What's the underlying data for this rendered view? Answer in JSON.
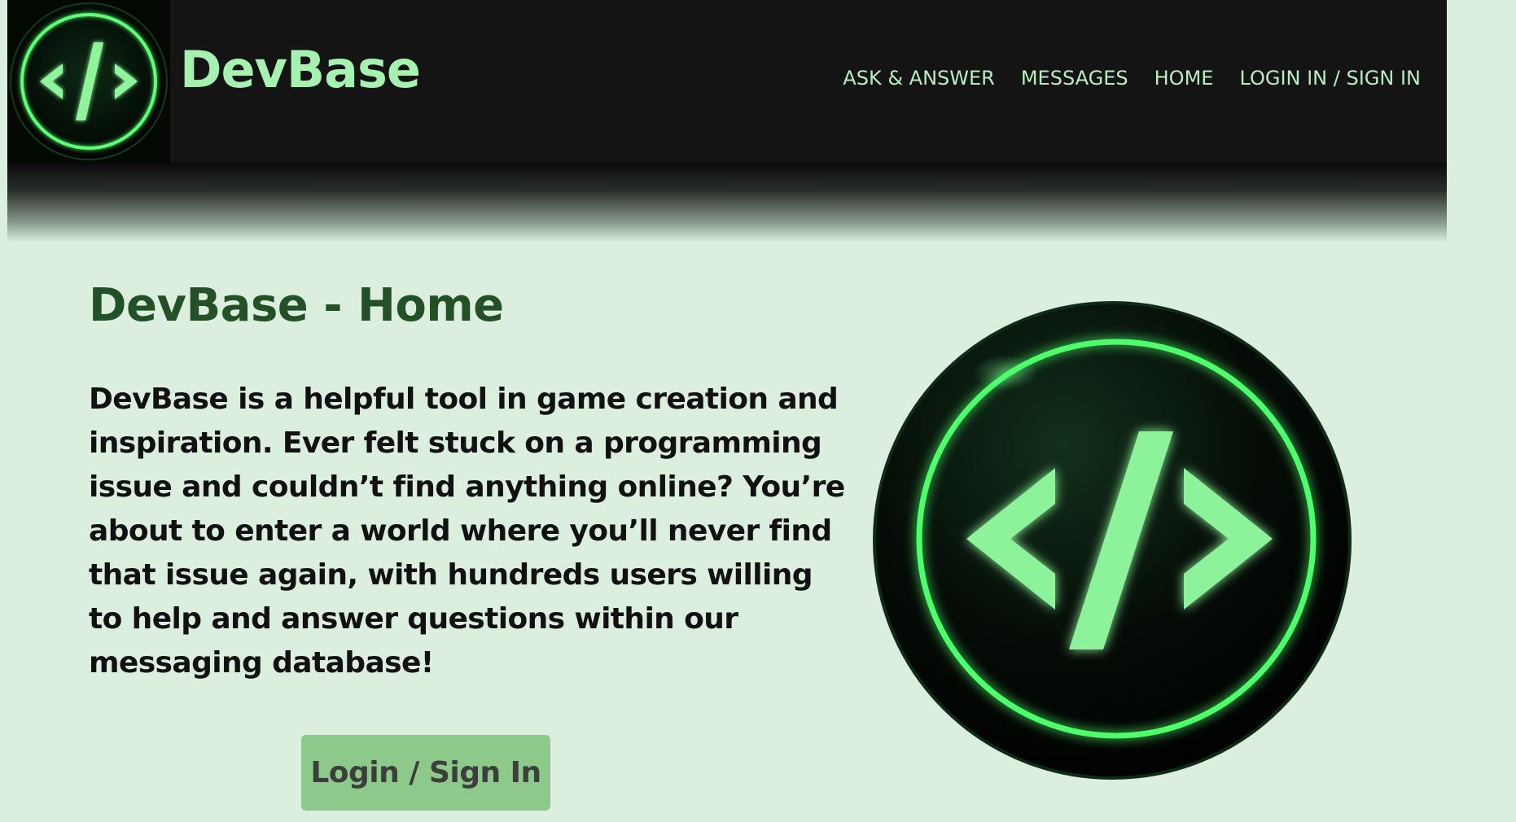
{
  "header": {
    "brand": "DevBase",
    "logo_icon": "code-brackets-icon",
    "nav": [
      {
        "label": "ASK & ANSWER"
      },
      {
        "label": "MESSAGES"
      },
      {
        "label": "HOME"
      },
      {
        "label": "LOGIN IN / SIGN IN"
      }
    ]
  },
  "main": {
    "title": "DevBase - Home",
    "intro": "DevBase is a helpful tool in game creation and inspiration. Ever felt stuck on a programming issue and couldn’t find anything online? You’re about to enter a world where you’ll never find that issue again, with hundreds users willing to help and answer questions within our messaging database!",
    "login_button": "Login / Sign In",
    "hero_icon": "code-brackets-icon"
  },
  "colors": {
    "background": "#dcefdf",
    "header": "#141414",
    "accent_green": "#8cc98a",
    "neon_green": "#7dff8a",
    "title_green": "#245028"
  }
}
